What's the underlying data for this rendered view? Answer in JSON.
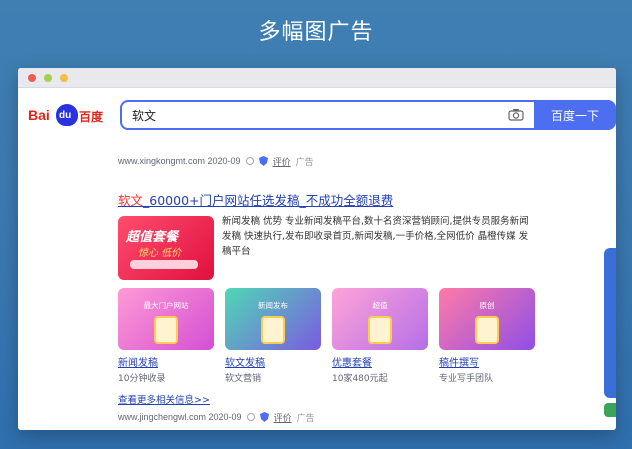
{
  "headline": "多幅图广告",
  "browser": {
    "logo_prefix": "Bai",
    "logo_paw_text": "du",
    "logo_cn": "百度",
    "query": "软文",
    "search_button": "百度一下"
  },
  "result1_meta": {
    "url": "www.xingkongmt.com 2020-09",
    "review": "评价",
    "ad": "广告"
  },
  "ad_result": {
    "title_highlight": "软文",
    "title_rest": "_60000+门户网站任选发稿_不成功全额退费",
    "banner_line1": "超值套餐",
    "banner_line2": "惊心 低价",
    "description": "新闻发稿 优势 专业新闻发稿平台,数十名资深营销顾问,提供专员服务新闻发稿 快速执行,发布即收录首页,新闻发稿,一手价格,全网低价 晶橙传媒 发稿平台",
    "cards": [
      {
        "caption": "最大门户网站",
        "name": "新闻发稿",
        "sub": "10分钟收录",
        "color_a": "#ff9ad5",
        "color_b": "#d44fd4"
      },
      {
        "caption": "新闻发布",
        "name": "软文发稿",
        "sub": "软文营销",
        "color_a": "#4fd8b5",
        "color_b": "#7b5be0"
      },
      {
        "caption": "超值",
        "name": "优惠套餐",
        "sub": "10家480元起",
        "color_a": "#ffa4d8",
        "color_b": "#b56ee8"
      },
      {
        "caption": "原创",
        "name": "稿件撰写",
        "sub": "专业写手团队",
        "color_a": "#ff7aa8",
        "color_b": "#8f4fe6"
      }
    ],
    "more_link": "查看更多相关信息>>"
  },
  "result2_meta": {
    "url": "www.jingchengwl.com 2020-09",
    "review": "评价",
    "ad": "广告"
  }
}
